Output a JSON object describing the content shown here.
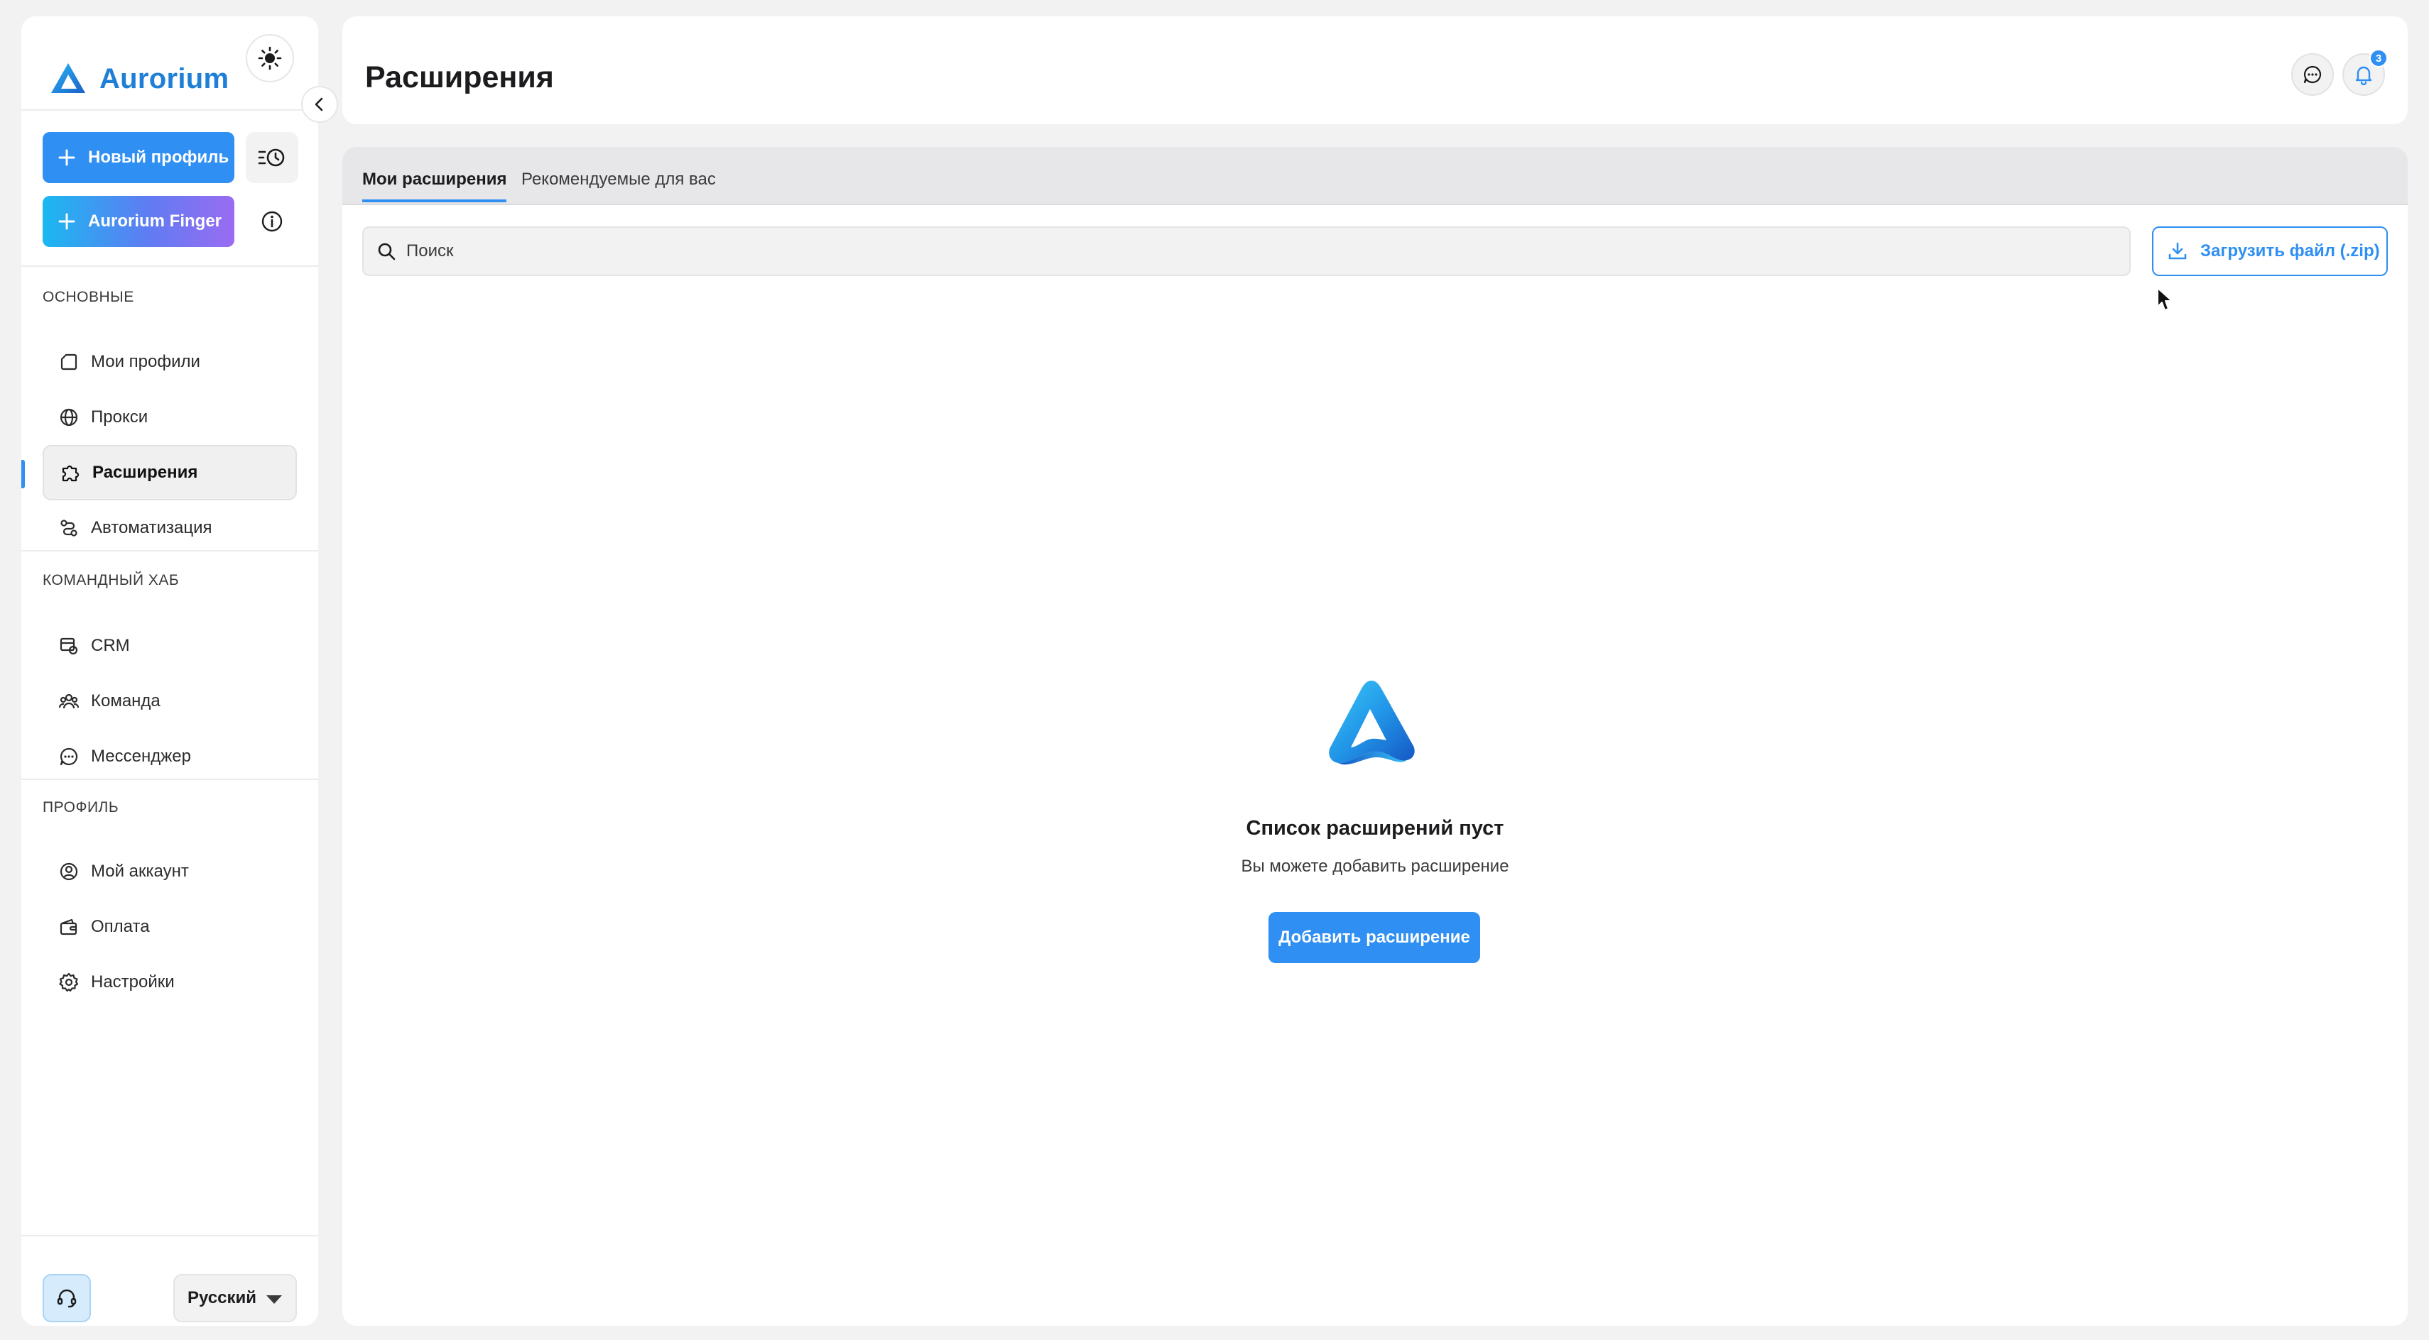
{
  "colors": {
    "accent": "#2f8ff2",
    "brand": "#1f7fd6",
    "background": "#f2f2f3",
    "panel": "#ffffff"
  },
  "brand": {
    "name": "Aurorium",
    "logo_icon": "aurorium-logo-icon"
  },
  "sidebar": {
    "new_profile_label": "Новый профиль",
    "finger_label": "Aurorium Finger",
    "sections": [
      {
        "title": "ОСНОВНЫЕ",
        "items": [
          {
            "label": "Мои профили",
            "icon": "folder-icon"
          },
          {
            "label": "Прокси",
            "icon": "globe-icon"
          },
          {
            "label": "Расширения",
            "icon": "puzzle-icon",
            "active": true
          },
          {
            "label": "Автоматизация",
            "icon": "automation-icon"
          }
        ]
      },
      {
        "title": "КОМАНДНЫЙ ХАБ",
        "items": [
          {
            "label": "CRM",
            "icon": "crm-icon"
          },
          {
            "label": "Команда",
            "icon": "team-icon"
          },
          {
            "label": "Мессенджер",
            "icon": "chat-icon"
          }
        ]
      },
      {
        "title": "ПРОФИЛЬ",
        "items": [
          {
            "label": "Мой аккаунт",
            "icon": "account-icon"
          },
          {
            "label": "Оплата",
            "icon": "wallet-icon"
          },
          {
            "label": "Настройки",
            "icon": "gear-icon"
          }
        ]
      }
    ],
    "language": "Русский"
  },
  "header": {
    "title": "Расширения",
    "notification_count": "3"
  },
  "main": {
    "tabs": [
      {
        "label": "Мои расширения",
        "active": true
      },
      {
        "label": "Рекомендуемые для вас",
        "active": false
      }
    ],
    "search_placeholder": "Поиск",
    "upload_label": "Загрузить файл (.zip)",
    "empty": {
      "title": "Список расширений пуст",
      "subtitle": "Вы можете добавить расширение",
      "button": "Добавить расширение"
    }
  }
}
